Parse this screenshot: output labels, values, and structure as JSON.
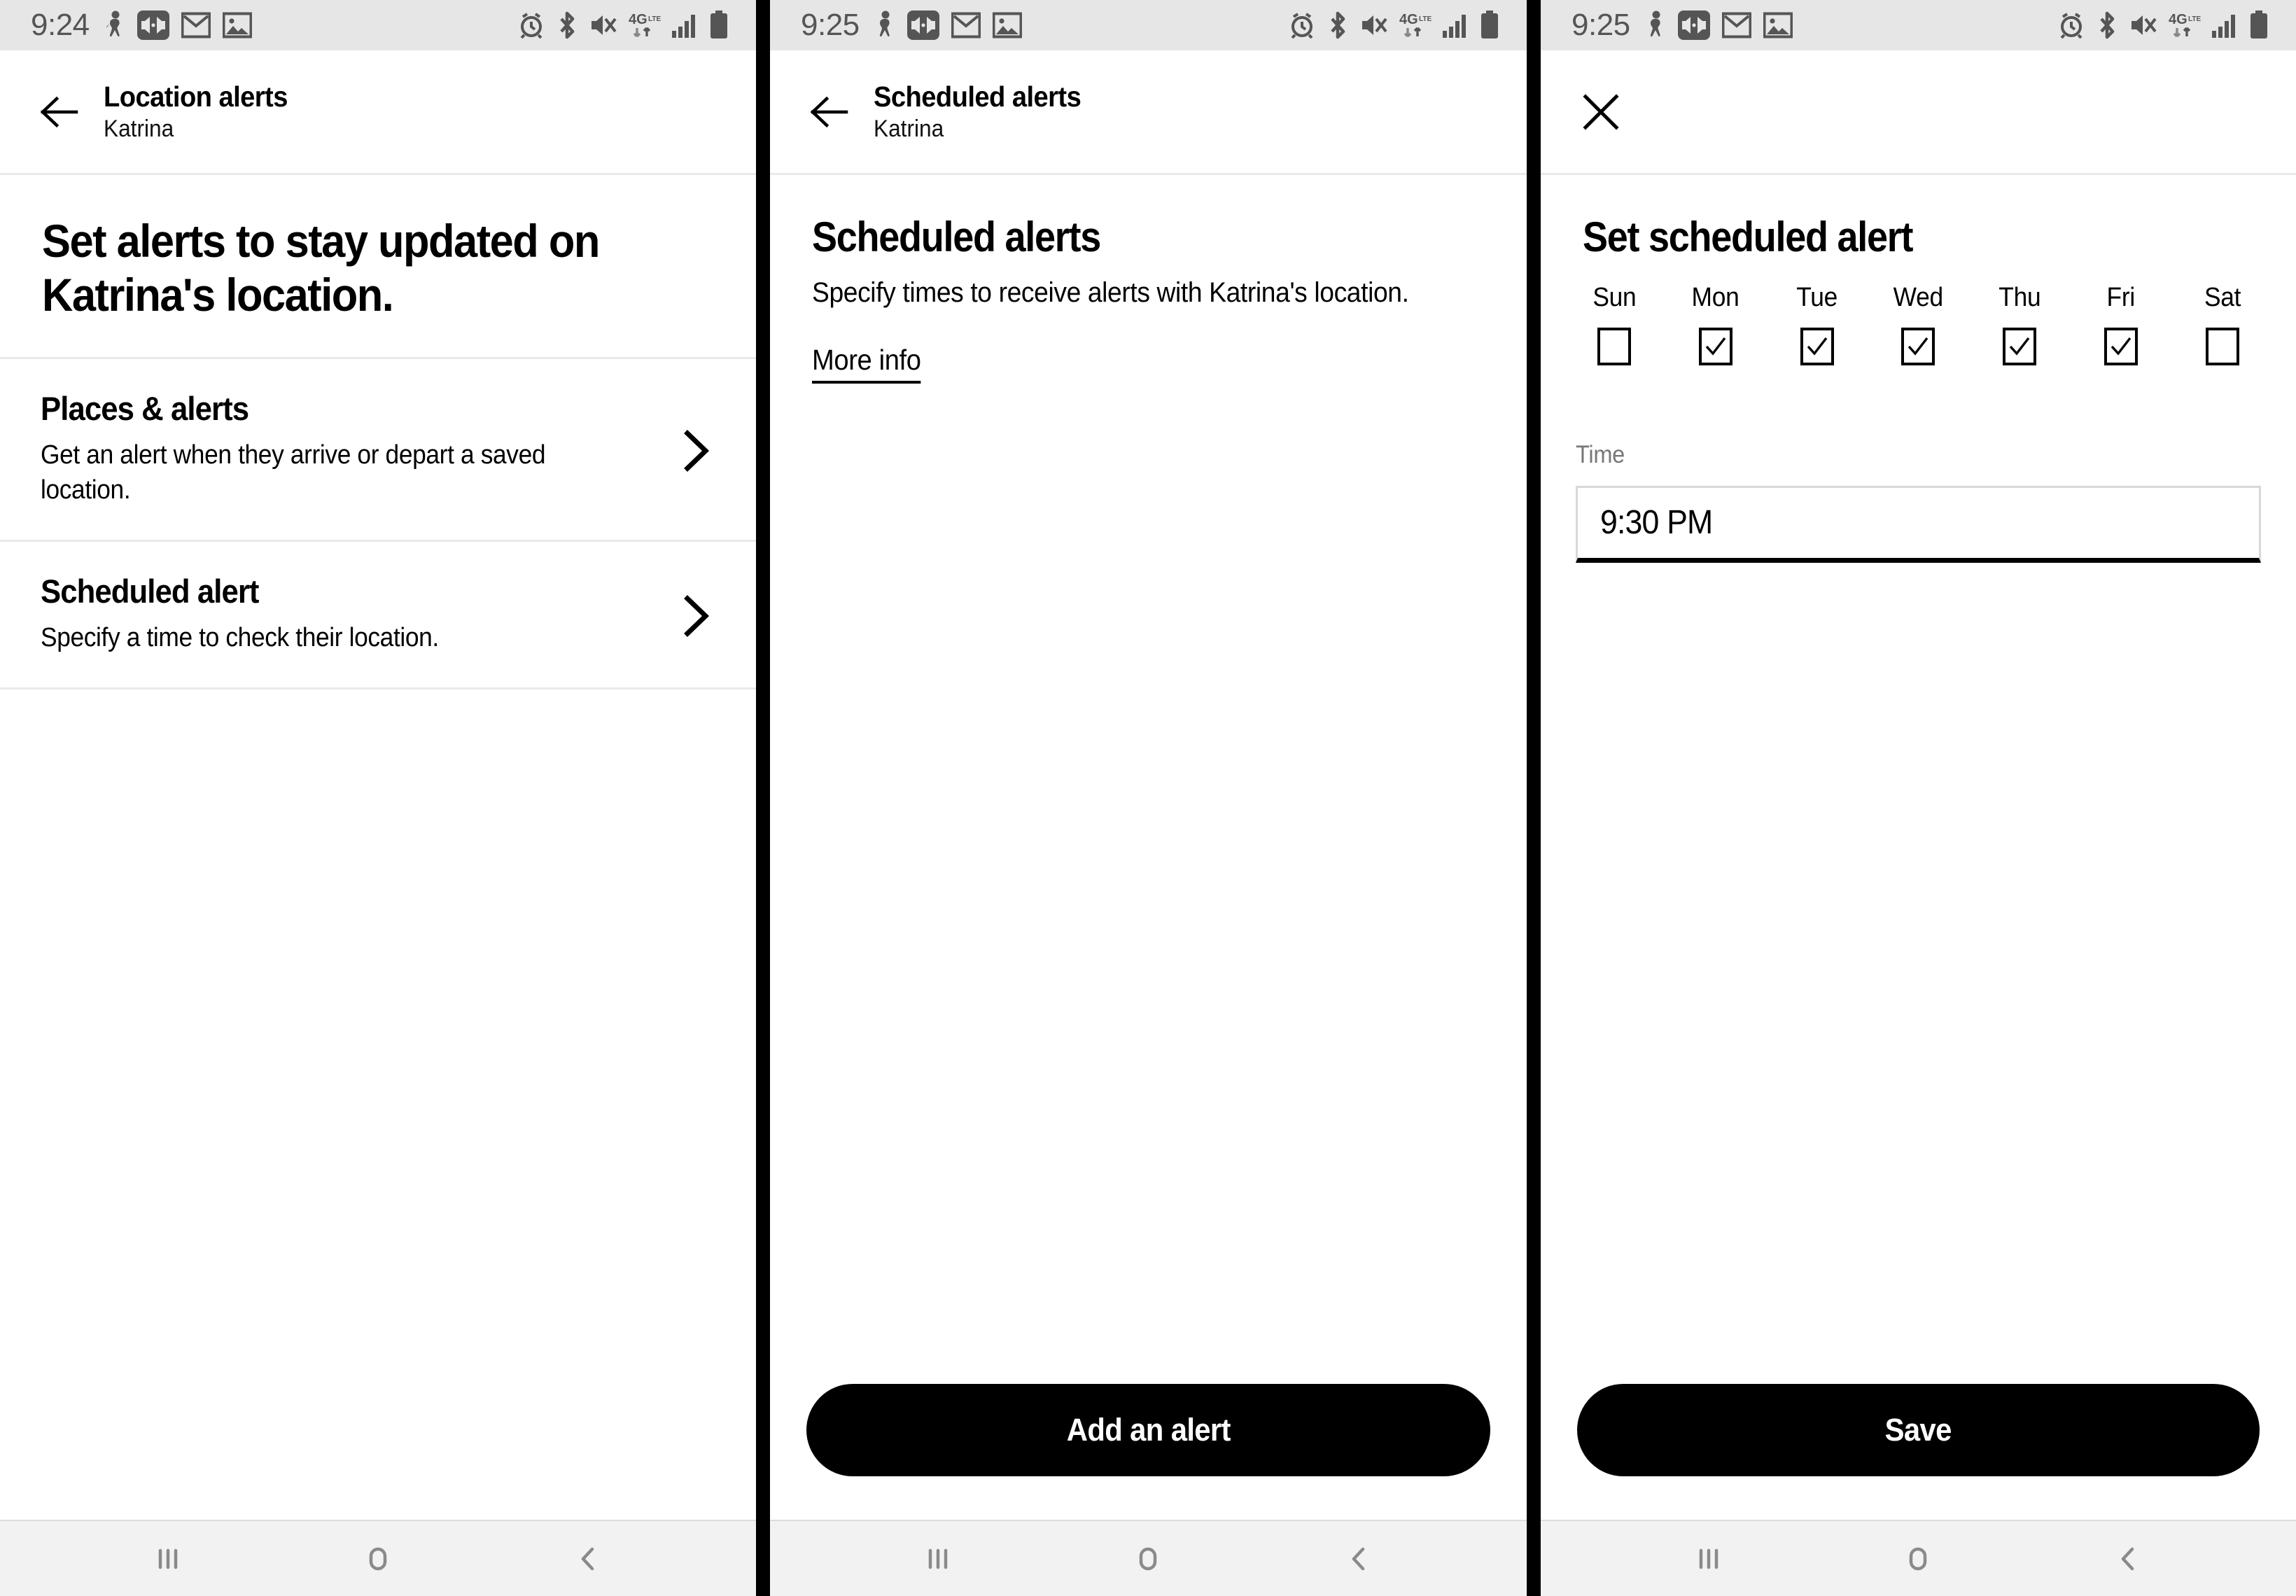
{
  "panels": [
    {
      "id": "location-alerts",
      "status_bar": {
        "time": "9:24",
        "notification_icons": [
          "person-activity-icon",
          "media-speaker-icon",
          "gmail-icon",
          "photo-gallery-icon"
        ],
        "system_icons": [
          "alarm-icon",
          "bluetooth-icon",
          "mute-icon",
          "4g-lte-data-icon",
          "signal-bars-icon",
          "battery-icon"
        ]
      },
      "header": {
        "back_icon": "back-arrow-icon",
        "title": "Location alerts",
        "subtitle": "Katrina"
      },
      "hero": {
        "heading": "Set alerts to stay updated on Katrina's location."
      },
      "rows": [
        {
          "title": "Places & alerts",
          "description": "Get an alert when they arrive or depart a saved location.",
          "chevron": "chevron-right-icon"
        },
        {
          "title": "Scheduled alert",
          "description": "Specify a time to check their location.",
          "chevron": "chevron-right-icon"
        }
      ],
      "nav_bar": {
        "recents_label": "recents-icon",
        "home_label": "home-icon",
        "back_label": "back-icon"
      }
    },
    {
      "id": "scheduled-alerts",
      "status_bar": {
        "time": "9:25",
        "notification_icons": [
          "person-activity-icon",
          "media-speaker-icon",
          "gmail-icon",
          "photo-gallery-icon"
        ],
        "system_icons": [
          "alarm-icon",
          "bluetooth-icon",
          "mute-icon",
          "4g-lte-data-icon",
          "signal-bars-icon",
          "battery-icon"
        ]
      },
      "header": {
        "back_icon": "back-arrow-icon",
        "title": "Scheduled alerts",
        "subtitle": "Katrina"
      },
      "hero": {
        "heading": "Scheduled alerts",
        "description": "Specify times to receive alerts with Katrina's location.",
        "more_info_link": "More info"
      },
      "cta": {
        "label": "Add an alert"
      },
      "nav_bar": {
        "recents_label": "recents-icon",
        "home_label": "home-icon",
        "back_label": "back-icon"
      }
    },
    {
      "id": "set-scheduled-alert",
      "status_bar": {
        "time": "9:25",
        "notification_icons": [
          "person-activity-icon",
          "media-speaker-icon",
          "gmail-icon",
          "photo-gallery-icon"
        ],
        "system_icons": [
          "alarm-icon",
          "bluetooth-icon",
          "mute-icon",
          "4g-lte-data-icon",
          "signal-bars-icon",
          "battery-icon"
        ]
      },
      "header": {
        "close_icon": "close-x-icon"
      },
      "hero": {
        "heading": "Set scheduled alert"
      },
      "days": [
        {
          "label": "Sun",
          "checked": false
        },
        {
          "label": "Mon",
          "checked": true
        },
        {
          "label": "Tue",
          "checked": true
        },
        {
          "label": "Wed",
          "checked": true
        },
        {
          "label": "Thu",
          "checked": true
        },
        {
          "label": "Fri",
          "checked": true
        },
        {
          "label": "Sat",
          "checked": false
        }
      ],
      "time_field": {
        "label": "Time",
        "value": "9:30 PM"
      },
      "cta": {
        "label": "Save"
      },
      "nav_bar": {
        "recents_label": "recents-icon",
        "home_label": "home-icon",
        "back_label": "back-icon"
      }
    }
  ],
  "colors": {
    "status_bar_bg": "#e6e6e6",
    "nav_bar_bg": "#f2f2f2",
    "panel_divider": "#000000",
    "rule": "#e9e9e9",
    "accent": "#000000",
    "muted_text": "#777777"
  }
}
